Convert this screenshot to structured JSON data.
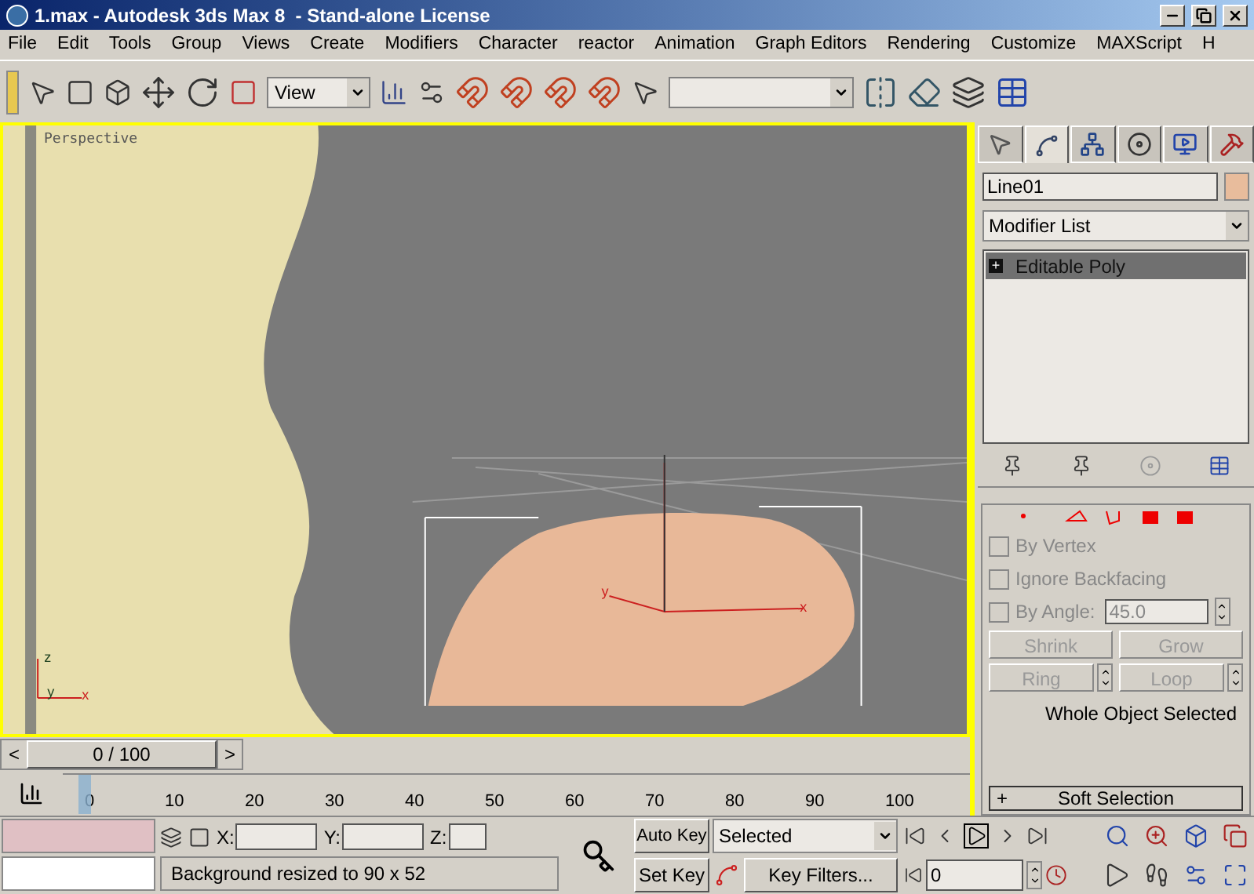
{
  "window": {
    "title": "1.max - Autodesk 3ds Max 8  - Stand-alone License",
    "controls": [
      {
        "kind": "minimize"
      },
      {
        "kind": "restore"
      },
      {
        "kind": "close"
      }
    ]
  },
  "menu": [
    {
      "label": "File"
    },
    {
      "label": "Edit"
    },
    {
      "label": "Tools"
    },
    {
      "label": "Group"
    },
    {
      "label": "Views"
    },
    {
      "label": "Create"
    },
    {
      "label": "Modifiers"
    },
    {
      "label": "Character"
    },
    {
      "label": "reactor"
    },
    {
      "label": "Animation"
    },
    {
      "label": "Graph Editors"
    },
    {
      "label": "Rendering"
    },
    {
      "label": "Customize"
    },
    {
      "label": "MAXScript"
    },
    {
      "label": "H"
    }
  ],
  "toolbar": {
    "reference_dropdown": "View"
  },
  "viewport": {
    "label": "Perspective",
    "active": true,
    "gizmo_labels": [
      {
        "kind": "y",
        "text": "y"
      },
      {
        "kind": "x",
        "text": "x"
      }
    ],
    "axis_labels": [
      {
        "kind": "z",
        "text": "z"
      },
      {
        "kind": "y",
        "text": "y"
      },
      {
        "kind": "x",
        "text": "x"
      }
    ]
  },
  "command_panel": {
    "tabs": [
      {
        "kind": "create",
        "selected": false
      },
      {
        "kind": "modify",
        "selected": true
      },
      {
        "kind": "hierarchy",
        "selected": false
      },
      {
        "kind": "motion",
        "selected": false
      },
      {
        "kind": "display",
        "selected": false
      },
      {
        "kind": "utilities",
        "selected": false
      }
    ],
    "object_name": "Line01",
    "modifier_list": "Modifier List",
    "stack": [
      {
        "label": "Editable Poly",
        "sign": "+",
        "selected": true
      }
    ],
    "selection_options": [
      {
        "label": "By Vertex",
        "checked": false
      },
      {
        "label": "Ignore Backfacing",
        "checked": false
      },
      {
        "label": "By Angle:",
        "checked": false,
        "value": "45.0"
      }
    ],
    "selection_buttons": [
      {
        "label": "Shrink",
        "spinner": false,
        "disabled": true
      },
      {
        "label": "Grow",
        "spinner": false,
        "disabled": true
      },
      {
        "label": "Ring",
        "spinner": true,
        "disabled": true
      },
      {
        "label": "Loop",
        "spinner": true,
        "disabled": true
      }
    ],
    "selection_status": "Whole Object Selected",
    "soft_selection": {
      "sign": "+",
      "label": "Soft Selection",
      "expanded": false
    }
  },
  "time_slider": {
    "prev": "<",
    "label": "0 / 100",
    "next": ">"
  },
  "track_bar": {
    "ticks": [
      "0",
      "10",
      "20",
      "30",
      "40",
      "50",
      "60",
      "70",
      "80",
      "90",
      "100"
    ]
  },
  "status": {
    "prompt": "Background resized to 90 x 52",
    "coords": [
      {
        "axis": "X:"
      },
      {
        "axis": "Y:"
      },
      {
        "axis": "Z:"
      }
    ]
  },
  "animation": {
    "auto_key": "Auto Key",
    "key_mode": "Selected",
    "set_key": "Set Key",
    "key_filters": "Key Filters...",
    "frame": "0"
  }
}
